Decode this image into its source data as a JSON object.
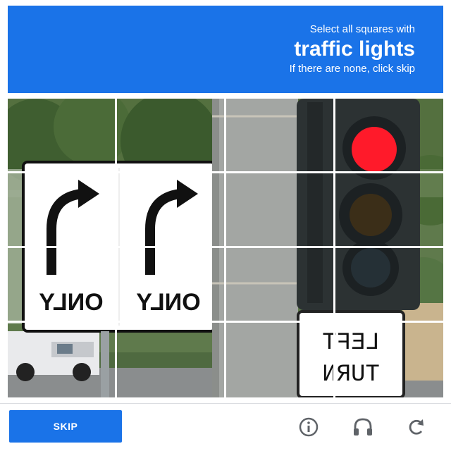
{
  "header": {
    "instruction_line1": "Select all squares with",
    "target_object": "traffic lights",
    "instruction_line3": "If there are none, click skip",
    "color": "#1a73e8"
  },
  "grid": {
    "rows": 4,
    "columns": 4,
    "tiles": [
      {
        "row": 1,
        "col": 1
      },
      {
        "row": 1,
        "col": 2
      },
      {
        "row": 1,
        "col": 3
      },
      {
        "row": 1,
        "col": 4
      },
      {
        "row": 2,
        "col": 1
      },
      {
        "row": 2,
        "col": 2
      },
      {
        "row": 2,
        "col": 3
      },
      {
        "row": 2,
        "col": 4
      },
      {
        "row": 3,
        "col": 1
      },
      {
        "row": 3,
        "col": 2
      },
      {
        "row": 3,
        "col": 3
      },
      {
        "row": 3,
        "col": 4
      },
      {
        "row": 4,
        "col": 1
      },
      {
        "row": 4,
        "col": 2
      },
      {
        "row": 4,
        "col": 3
      },
      {
        "row": 4,
        "col": 4
      }
    ],
    "scene_text": {
      "sign_left": "ONLY",
      "sign_right": "ONLY",
      "turn_sign_line1": "LEFT",
      "turn_sign_line2": "TURN"
    }
  },
  "footer": {
    "skip_label": "SKIP",
    "icons": [
      "info-icon",
      "headphones-icon",
      "reload-icon"
    ]
  }
}
